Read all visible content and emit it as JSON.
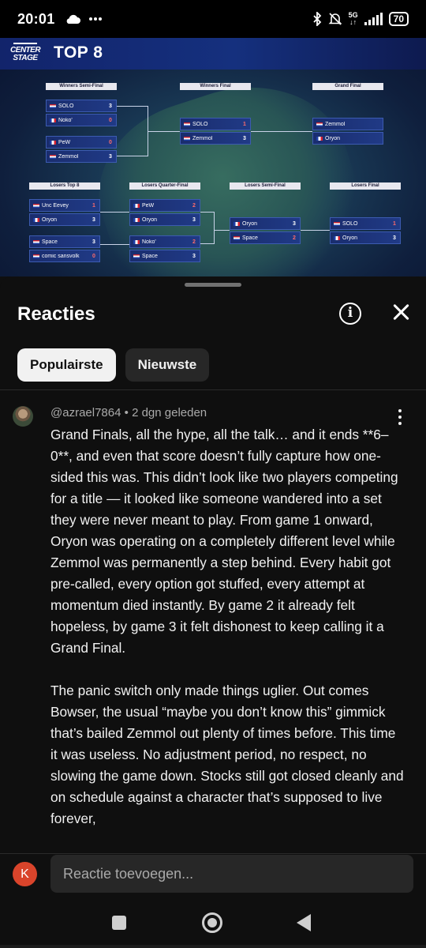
{
  "status_bar": {
    "time": "20:01",
    "battery": "70",
    "network": "5G",
    "icons": [
      "cloud-icon",
      "more-dots-icon",
      "bluetooth-icon",
      "mute-icon",
      "signal-icon",
      "battery-icon"
    ]
  },
  "video": {
    "logo_text": "CENTER STAGE",
    "title": "TOP 8",
    "rounds": {
      "winners_semi": "Winners Semi-Final",
      "winners_final": "Winners Final",
      "grand_final": "Grand Final",
      "losers_top8": "Losers Top 8",
      "losers_quarter": "Losers Quarter-Final",
      "losers_semi": "Losers Semi-Final",
      "losers_final": "Losers Final"
    },
    "matches": {
      "ws1": [
        {
          "name": "SOLO",
          "score": "3"
        },
        {
          "name": "Noko'",
          "score": "0"
        }
      ],
      "ws2": [
        {
          "name": "PeW",
          "score": "0"
        },
        {
          "name": "Zemmol",
          "score": "3"
        }
      ],
      "wf": [
        {
          "name": "SOLO",
          "score": "1"
        },
        {
          "name": "Zemmol",
          "score": "3"
        }
      ],
      "gf": [
        {
          "name": "Zemmol",
          "score": ""
        },
        {
          "name": "Oryon",
          "score": ""
        }
      ],
      "l8a": [
        {
          "name": "Unc Eevey",
          "score": "1"
        },
        {
          "name": "Oryon",
          "score": "3"
        }
      ],
      "l8b": [
        {
          "name": "Space",
          "score": "3"
        },
        {
          "name": "comic sansvolk",
          "score": "0"
        }
      ],
      "lqa": [
        {
          "name": "PeW",
          "score": "2"
        },
        {
          "name": "Oryon",
          "score": "3"
        }
      ],
      "lqb": [
        {
          "name": "Noko'",
          "score": "2"
        },
        {
          "name": "Space",
          "score": "3"
        }
      ],
      "ls": [
        {
          "name": "Oryon",
          "score": "3"
        },
        {
          "name": "Space",
          "score": "2"
        }
      ],
      "lf": [
        {
          "name": "SOLO",
          "score": "1"
        },
        {
          "name": "Oryon",
          "score": "3"
        }
      ]
    }
  },
  "comments": {
    "title": "Reacties",
    "info_icon": "info-icon",
    "close_icon": "close-icon",
    "tabs": [
      {
        "label": "Populairste",
        "active": true
      },
      {
        "label": "Nieuwste",
        "active": false
      }
    ],
    "items": [
      {
        "author": "@azrael7864",
        "separator": "•",
        "time": "2 dgn geleden",
        "paragraphs": [
          "Grand Finals, all the hype, all the talk… and it ends **6–0**, and even that score doesn’t fully capture how one-sided this was. This didn’t look like two players competing for a title — it looked like someone wandered into a set they were never meant to play. From game 1 onward, Oryon was operating on a completely different level while Zemmol was permanently a step behind. Every habit got pre-called, every option got stuffed, every attempt at momentum died instantly. By game 2 it already felt hopeless, by game 3 it felt dishonest to keep calling it a Grand Final.",
          "The panic switch only made things uglier. Out comes Bowser, the usual “maybe you don’t know this” gimmick that’s bailed Zemmol out plenty of times before. This time it was useless. No adjustment period, no respect, no slowing the game down. Stocks still got closed cleanly and on schedule against a character that’s supposed to live forever,"
        ]
      }
    ],
    "reply": {
      "avatar_letter": "K",
      "placeholder": "Reactie toevoegen..."
    }
  },
  "colors": {
    "background": "#0f0f0f",
    "chip_active": "#f1f1f1",
    "chip_inactive": "#272727",
    "avatar": "#d9442b"
  }
}
